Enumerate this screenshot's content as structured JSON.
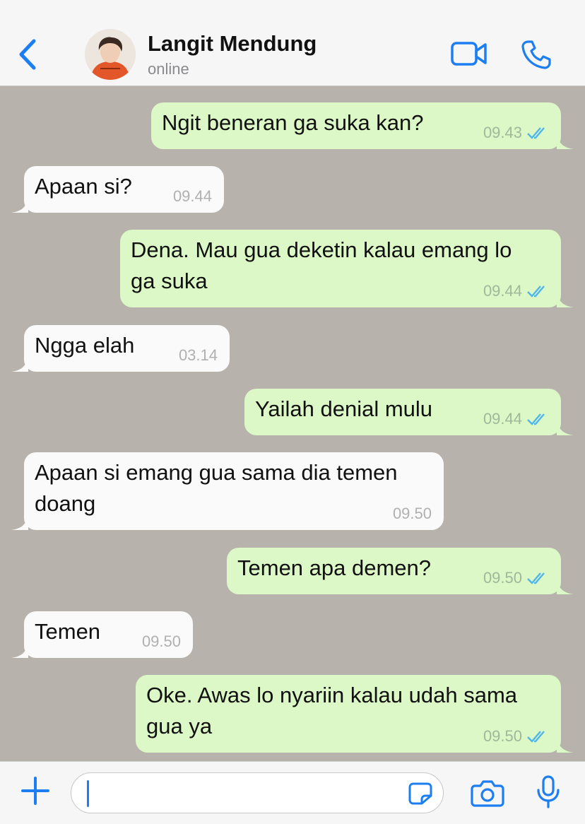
{
  "header": {
    "contact_name": "Langit Mendung",
    "status": "online"
  },
  "messages": [
    {
      "dir": "out",
      "lines": [
        "Ngit beneran ga suka kan?"
      ],
      "time": "09.43",
      "read": true
    },
    {
      "dir": "in",
      "lines": [
        "Apaan si?"
      ],
      "time": "09.44"
    },
    {
      "dir": "out",
      "lines": [
        "Dena. Mau gua deketin kalau emang lo",
        "ga suka"
      ],
      "time": "09.44",
      "read": true
    },
    {
      "dir": "in",
      "lines": [
        "Ngga elah"
      ],
      "time": "03.14"
    },
    {
      "dir": "out",
      "lines": [
        "Yailah denial mulu"
      ],
      "time": "09.44",
      "read": true
    },
    {
      "dir": "in",
      "lines": [
        "Apaan si emang gua sama dia temen",
        "doang"
      ],
      "time": "09.50"
    },
    {
      "dir": "out",
      "lines": [
        "Temen apa demen?"
      ],
      "time": "09.50",
      "read": true
    },
    {
      "dir": "in",
      "lines": [
        "Temen"
      ],
      "time": "09.50"
    },
    {
      "dir": "out",
      "lines": [
        "Oke. Awas lo nyariin kalau udah sama",
        "gua ya"
      ],
      "time": "09.50",
      "read": true
    }
  ],
  "composer": {
    "input_value": ""
  },
  "colors": {
    "accent": "#1d7ef2",
    "incoming_bubble": "#fafafa",
    "outgoing_bubble": "#dcf8c6",
    "chat_background": "#b7b2ac",
    "read_ticks": "#4fb6ec"
  },
  "icons": [
    "chevron-left-icon",
    "video-camera-icon",
    "phone-icon",
    "plus-icon",
    "sticker-icon",
    "camera-icon",
    "microphone-icon",
    "double-check-icon"
  ]
}
